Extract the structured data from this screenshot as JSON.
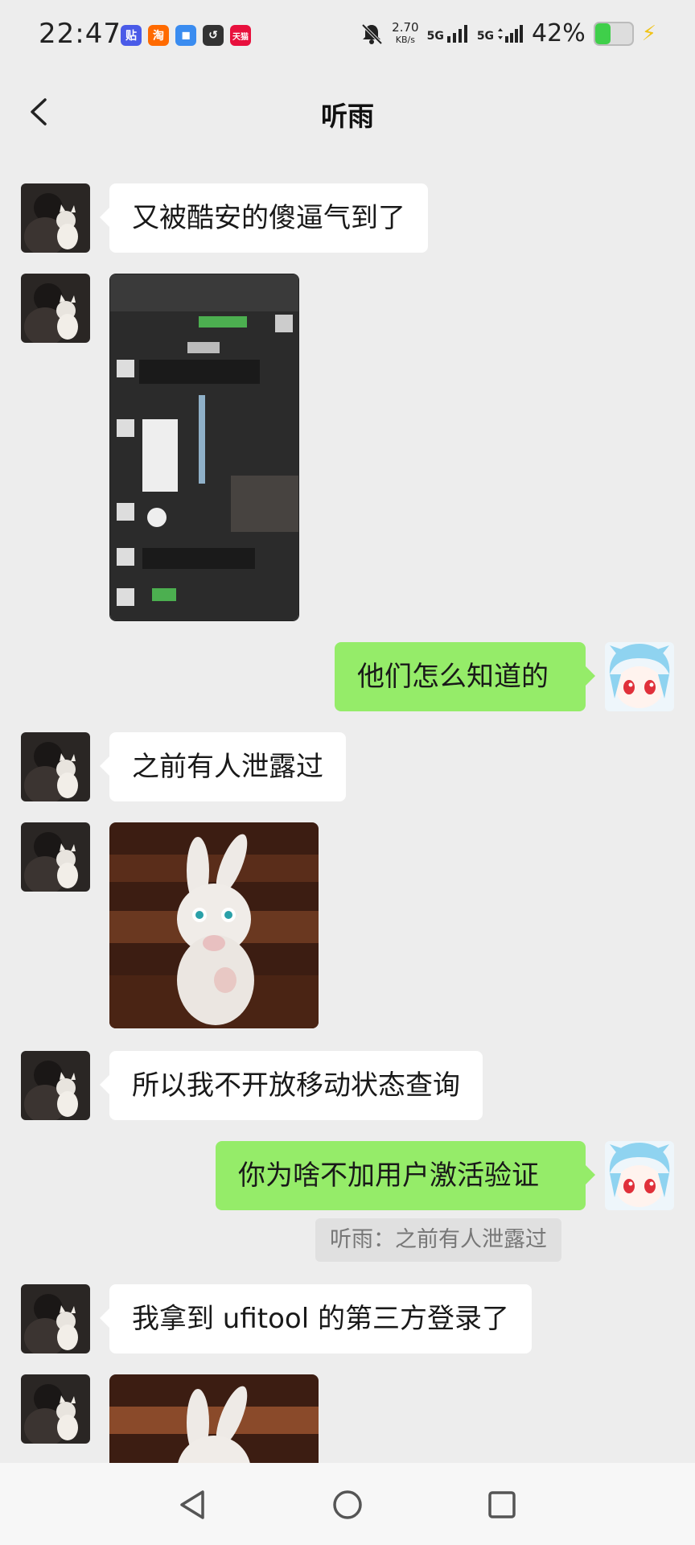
{
  "status": {
    "time": "22:47",
    "apps": [
      {
        "name": "tieba-icon",
        "label": "贴",
        "color": "#4a5be8"
      },
      {
        "name": "taobao-icon",
        "label": "淘",
        "color": "#ff6a00"
      },
      {
        "name": "message-app-icon",
        "label": "◼",
        "color": "#3a8cf0"
      },
      {
        "name": "link-app-icon",
        "label": "↺",
        "color": "#333333"
      },
      {
        "name": "tmall-icon",
        "label": "天猫",
        "color": "#e8103d"
      }
    ],
    "net_speed_value": "2.70",
    "net_speed_unit": "KB/s",
    "sim1": "5G",
    "sim2": "5G",
    "battery": "42%",
    "battery_level": 0.42
  },
  "header": {
    "title": "听雨"
  },
  "messages": [
    {
      "side": "left",
      "type": "text",
      "text": "又被酷安的傻逼气到了"
    },
    {
      "side": "left",
      "type": "image",
      "image": "screenshot"
    },
    {
      "side": "right",
      "type": "text",
      "text": "他们怎么知道的"
    },
    {
      "side": "left",
      "type": "text",
      "text": "之前有人泄露过"
    },
    {
      "side": "left",
      "type": "image",
      "image": "rabbit"
    },
    {
      "side": "left",
      "type": "text",
      "text": "所以我不开放移动状态查询"
    },
    {
      "side": "right",
      "type": "text",
      "text": "你为啥不加用户激活验证"
    },
    {
      "side": "right",
      "type": "quote",
      "text": "听雨：之前有人泄露过"
    },
    {
      "side": "left",
      "type": "text",
      "text": "我拿到 ufitool 的第三方登录了"
    },
    {
      "side": "left",
      "type": "image",
      "image": "rabbit"
    }
  ],
  "nav": {
    "back": "back-nav-icon",
    "home": "home-nav-icon",
    "recents": "recents-nav-icon"
  },
  "colors": {
    "background": "#ededed",
    "self_bubble": "#95ec69",
    "other_bubble": "#ffffff"
  }
}
